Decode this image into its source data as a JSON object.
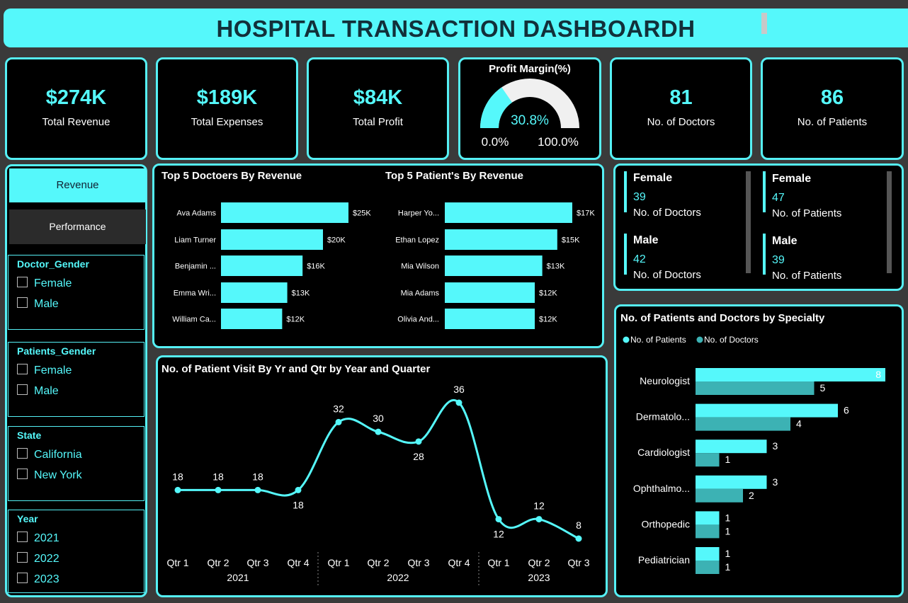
{
  "title": "HOSPITAL TRANSACTION DASHBOARDH",
  "kpis": {
    "revenue": {
      "value": "$274K",
      "label": "Total Revenue"
    },
    "expenses": {
      "value": "$189K",
      "label": "Total Expenses"
    },
    "profit": {
      "value": "$84K",
      "label": "Total Profit"
    },
    "doctors": {
      "value": "81",
      "label": "No. of Doctors"
    },
    "patients": {
      "value": "86",
      "label": "No. of Patients"
    }
  },
  "gauge": {
    "title": "Profit Margin(%)",
    "value_label": "30.8%",
    "value": 0.308,
    "min_label": "0.0%",
    "max_label": "100.0%"
  },
  "nav": {
    "revenue": "Revenue",
    "performance": "Performance"
  },
  "slicers": {
    "doctor_gender": {
      "header": "Doctor_Gender",
      "options": [
        "Female",
        "Male"
      ]
    },
    "patients_gender": {
      "header": "Patients_Gender",
      "options": [
        "Female",
        "Male"
      ]
    },
    "state": {
      "header": "State",
      "options": [
        "California",
        "New York"
      ]
    },
    "year": {
      "header": "Year",
      "options": [
        "2021",
        "2022",
        "2023"
      ]
    }
  },
  "gender_cards": {
    "doctors_female": {
      "gender": "Female",
      "count": "39",
      "label": "No. of Doctors"
    },
    "patients_female": {
      "gender": "Female",
      "count": "47",
      "label": "No. of Patients"
    },
    "doctors_male": {
      "gender": "Male",
      "count": "42",
      "label": "No. of Doctors"
    },
    "patients_male": {
      "gender": "Male",
      "count": "39",
      "label": "No. of Patients"
    }
  },
  "colors": {
    "accent": "#55f8fb",
    "accent_dark": "#3cb2b4",
    "panel": "#000000",
    "background": "#3a3a3a"
  },
  "chart_data": [
    {
      "type": "bar",
      "title": "Top 5 Doctoers By Revenue",
      "categories": [
        "Ava Adams",
        "Liam Turner",
        "Benjamin ...",
        "Emma Wri...",
        "William Ca..."
      ],
      "values": [
        25,
        20,
        16,
        13,
        12
      ],
      "value_labels": [
        "$25K",
        "$20K",
        "$16K",
        "$13K",
        "$12K"
      ],
      "orientation": "horizontal"
    },
    {
      "type": "bar",
      "title": "Top 5 Patient's By Revenue",
      "categories": [
        "Harper Yo...",
        "Ethan Lopez",
        "Mia Wilson",
        "Mia Adams",
        "Olivia And..."
      ],
      "values": [
        17,
        15,
        13,
        12,
        12
      ],
      "value_labels": [
        "$17K",
        "$15K",
        "$13K",
        "$12K",
        "$12K"
      ],
      "orientation": "horizontal"
    },
    {
      "type": "line",
      "title": "No. of Patient Visit By Yr and Qtr by Year and Quarter",
      "x": [
        "Qtr 1",
        "Qtr 2",
        "Qtr 3",
        "Qtr 4",
        "Qtr 1",
        "Qtr 2",
        "Qtr 3",
        "Qtr 4",
        "Qtr 1",
        "Qtr 2",
        "Qtr 3"
      ],
      "groups": [
        "2021",
        "2022",
        "2023"
      ],
      "values": [
        18,
        18,
        18,
        18,
        32,
        30,
        28,
        36,
        12,
        12,
        8
      ]
    },
    {
      "type": "bar",
      "title": "No. of Patients and Doctors by Specialty",
      "orientation": "horizontal",
      "legend": "top-left",
      "categories": [
        "Neurologist",
        "Dermatolo...",
        "Cardiologist",
        "Ophthalmo...",
        "Orthopedic",
        "Pediatrician"
      ],
      "series": [
        {
          "name": "No. of Patients",
          "values": [
            8,
            6,
            3,
            3,
            1,
            1
          ]
        },
        {
          "name": "No. of Doctors",
          "values": [
            5,
            4,
            1,
            2,
            1,
            1
          ]
        }
      ]
    }
  ]
}
